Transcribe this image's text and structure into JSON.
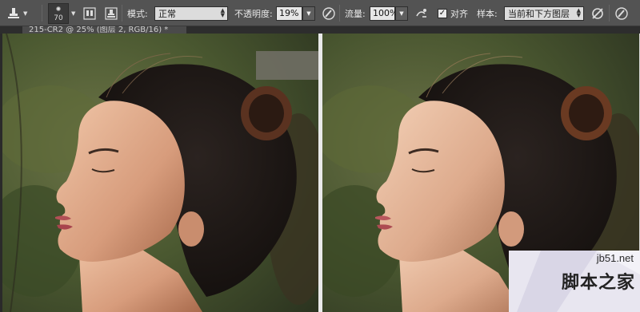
{
  "options_bar": {
    "tool_icon": "clone-stamp-icon",
    "brush_size": "70",
    "toggle_brush_panel_icon": "brush-panel-icon",
    "toggle_clone_source_icon": "clone-source-icon",
    "mode_label": "模式:",
    "mode_value": "正常",
    "opacity_label": "不透明度:",
    "opacity_value": "19%",
    "pressure_opacity_icon": "pressure-opacity-icon",
    "flow_label": "流量:",
    "flow_value": "100%",
    "airbrush_icon": "airbrush-icon",
    "aligned_checked": true,
    "aligned_label": "对齐",
    "sample_label": "样本:",
    "sample_value": "当前和下方图层",
    "ignore_adjustment_icon": "ignore-adjustment-layers-icon",
    "pressure_size_icon": "pressure-size-icon"
  },
  "document_tab": {
    "title": "215-CR2 @ 25% (图层 2, RGB/16) *"
  },
  "watermark": {
    "site": "jb51.net",
    "name": "脚本之家"
  },
  "colors": {
    "panel_bg": "#535353",
    "canvas_bg": "#2a2a2a",
    "divider": "#e9e9e9"
  }
}
